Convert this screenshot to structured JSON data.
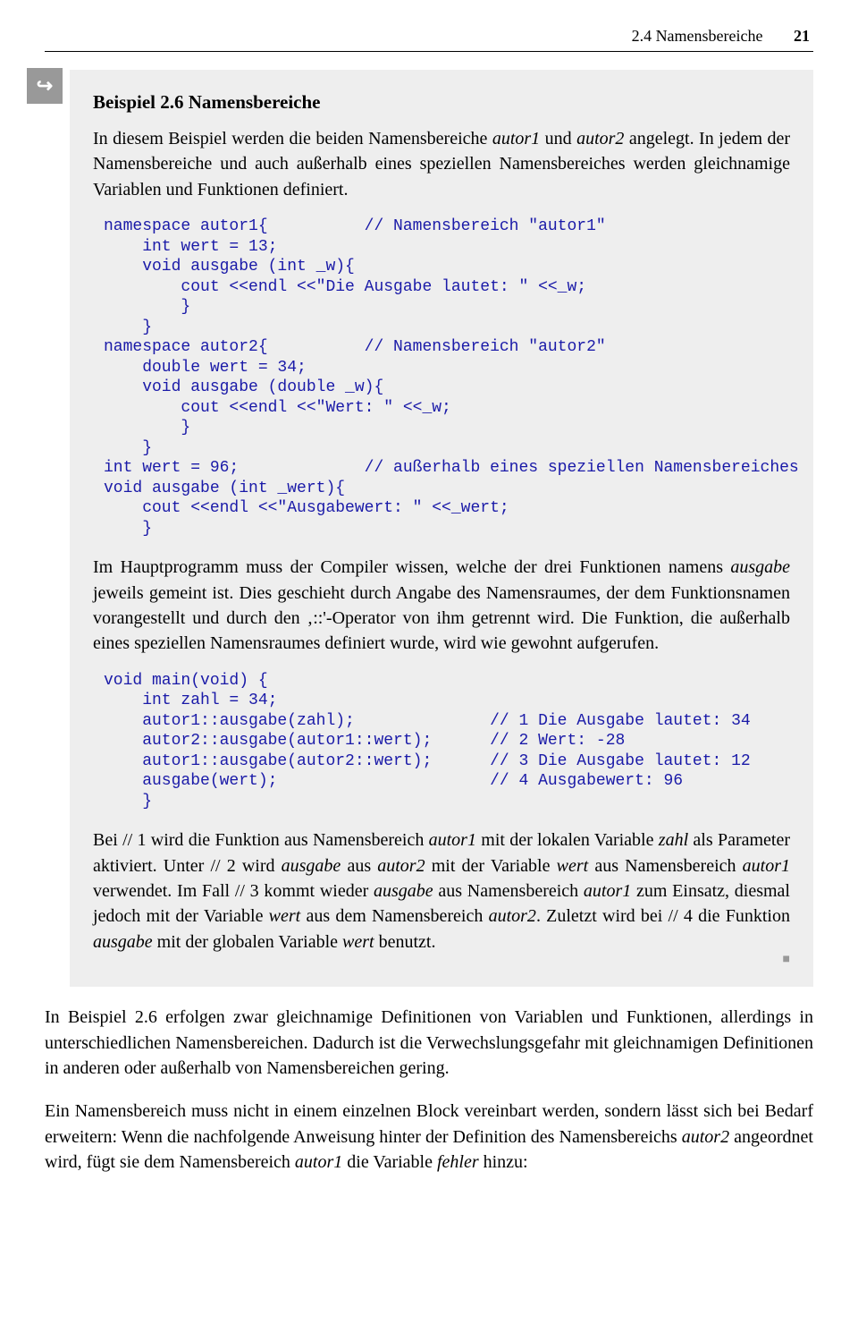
{
  "header": {
    "section": "2.4 Namensbereiche",
    "page": "21"
  },
  "example": {
    "icon": "↪",
    "title": "Beispiel 2.6 Namensbereiche",
    "intro_html": "In diesem Beispiel werden die beiden Namensbereiche <em class=\"it\">autor1</em> und <em class=\"it\">autor2</em> angelegt. In jedem der Namensbereiche und auch außerhalb eines speziellen Namensbereiches werden gleichnamige Variablen und Funktionen definiert.",
    "code1": "namespace autor1{          // Namensbereich \"autor1\"\n    int wert = 13;\n    void ausgabe (int _w){\n        cout <<endl <<\"Die Ausgabe lautet: \" <<_w;\n        }\n    }\nnamespace autor2{          // Namensbereich \"autor2\"\n    double wert = 34;\n    void ausgabe (double _w){\n        cout <<endl <<\"Wert: \" <<_w;\n        }\n    }\nint wert = 96;             // außerhalb eines speziellen Namensbereiches\nvoid ausgabe (int _wert){\n    cout <<endl <<\"Ausgabewert: \" <<_wert;\n    }",
    "mid_html": "Im Hauptprogramm muss der Compiler wissen, welche der drei Funktionen namens <em class=\"it\">ausgabe</em> jeweils gemeint ist. Dies geschieht durch Angabe des Namensraumes, der dem Funktionsnamen vorangestellt und durch den ‚::'-Operator von ihm getrennt wird. Die Funktion, die außerhalb eines speziellen Namensraumes definiert wurde, wird wie gewohnt aufgerufen.",
    "code2": "void main(void) {\n    int zahl = 34;\n    autor1::ausgabe(zahl);              // 1 Die Ausgabe lautet: 34\n    autor2::ausgabe(autor1::wert);      // 2 Wert: -28\n    autor1::ausgabe(autor2::wert);      // 3 Die Ausgabe lautet: 12\n    ausgabe(wert);                      // 4 Ausgabewert: 96\n    }",
    "outro_html": "Bei // 1 wird die Funktion aus Namensbereich <em class=\"it\">autor1</em> mit der lokalen Variable <em class=\"it\">zahl</em> als Parameter aktiviert. Unter // 2 wird <em class=\"it\">ausgabe</em> aus <em class=\"it\">autor2</em> mit der Variable <em class=\"it\">wert</em> aus Namensbereich <em class=\"it\">autor1</em> verwendet. Im Fall // 3 kommt wieder <em class=\"it\">ausgabe</em> aus Namensbereich <em class=\"it\">autor1</em> zum Einsatz, diesmal jedoch mit der Variable <em class=\"it\">wert</em> aus dem Namensbereich <em class=\"it\">autor2</em>. Zuletzt wird bei // 4 die Funktion <em class=\"it\">ausgabe</em> mit der globalen Variable <em class=\"it\">wert</em> benutzt.",
    "end_mark": "■"
  },
  "body": {
    "p1": "In Beispiel 2.6 erfolgen zwar gleichnamige Definitionen von Variablen und Funktionen, allerdings in unterschiedlichen Namensbereichen. Dadurch ist die Verwechslungsgefahr mit gleichnamigen Definitionen in anderen oder außerhalb von Namensbereichen gering.",
    "p2_html": "Ein Namensbereich muss nicht in einem einzelnen Block vereinbart werden, sondern lässt sich bei Bedarf erweitern: Wenn die nachfolgende Anweisung hinter der Definition des Namensbereichs <em class=\"it\">autor2</em> angeordnet wird, fügt sie dem Namensbereich <em class=\"it\">autor1</em> die Variable <em class=\"it\">fehler</em> hinzu:"
  }
}
